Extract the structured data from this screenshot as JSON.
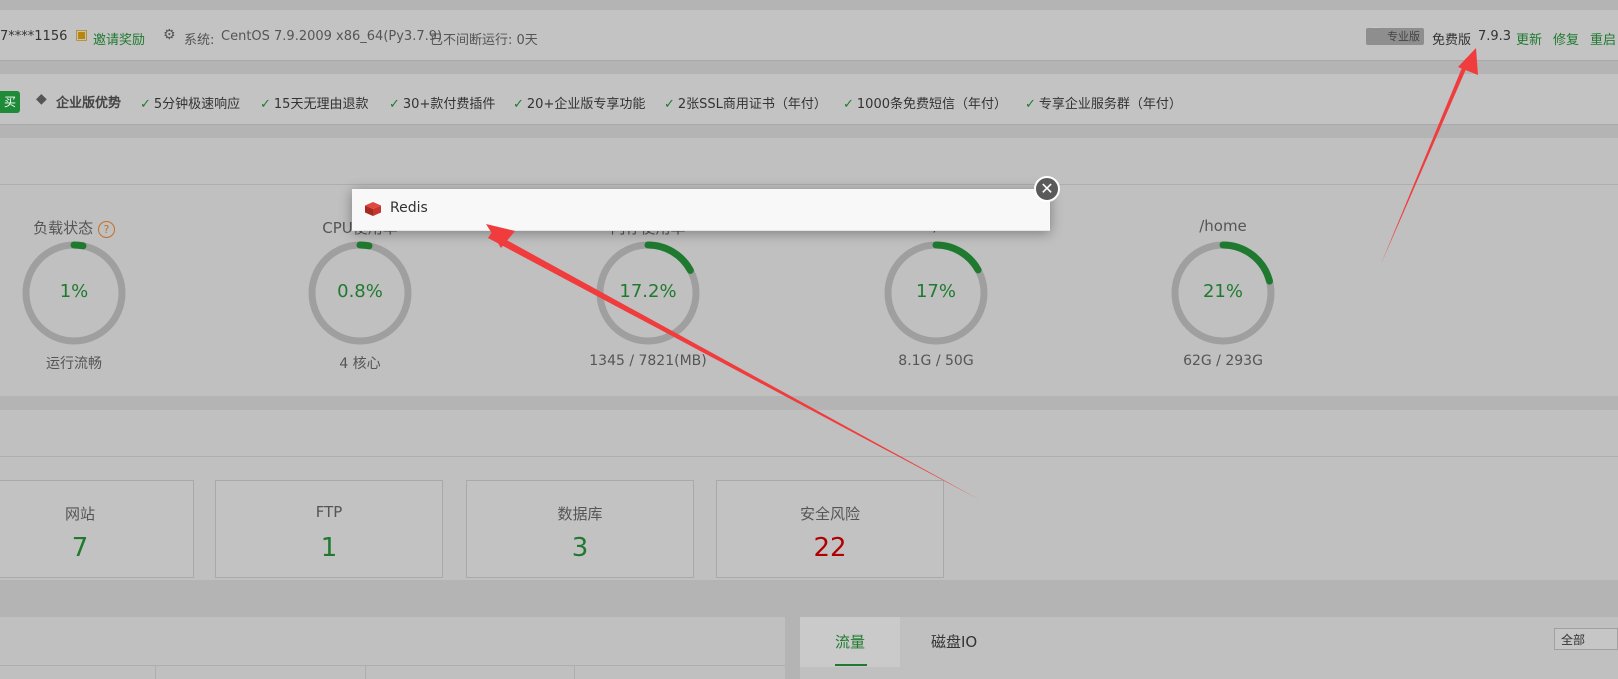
{
  "topbar": {
    "user": "7****1156",
    "invite_label": "邀请奖励",
    "system_label": "系统:",
    "system_value": "CentOS 7.9.2009 x86_64(Py3.7.9)",
    "uptime": "已不间断运行: 0天",
    "pro_label": "专业版",
    "free_label": "免费版",
    "version": "7.9.3",
    "update_label": "更新",
    "repair_label": "修复",
    "restart_label": "重启"
  },
  "promo": {
    "buy_label": "买",
    "enterprise_label": "企业版优势",
    "features": [
      "5分钟极速响应",
      "15天无理由退款",
      "30+款付费插件",
      "20+企业版专享功能",
      "2张SSL商用证书（年付）",
      "1000条免费短信（年付）",
      "专享企业服务群（年付）"
    ]
  },
  "status": {
    "gauges": [
      {
        "title": "负载状态",
        "value": "1%",
        "percent": 1,
        "sub": "运行流畅"
      },
      {
        "title": "CPU使用率",
        "value": "0.8%",
        "percent": 0.8,
        "sub": "4 核心"
      },
      {
        "title": "内存使用率",
        "value": "17.2%",
        "percent": 17.2,
        "sub": "1345 / 7821(MB)"
      },
      {
        "title": "/",
        "value": "17%",
        "percent": 17,
        "sub": "8.1G / 50G"
      },
      {
        "title": "/home",
        "value": "21%",
        "percent": 21,
        "sub": "62G / 293G"
      }
    ]
  },
  "overview": {
    "cards": [
      {
        "label": "网站",
        "value": "7"
      },
      {
        "label": "FTP",
        "value": "1"
      },
      {
        "label": "数据库",
        "value": "3"
      },
      {
        "label": "安全风险",
        "value": "22"
      }
    ]
  },
  "traffic": {
    "tabs": [
      "流量",
      "磁盘IO"
    ],
    "select_value": "全部"
  },
  "modal": {
    "title": "Redis"
  },
  "colors": {
    "accent_green": "#1f7a2f",
    "danger_red": "#b00000",
    "arrow_red": "#f03c3c"
  }
}
